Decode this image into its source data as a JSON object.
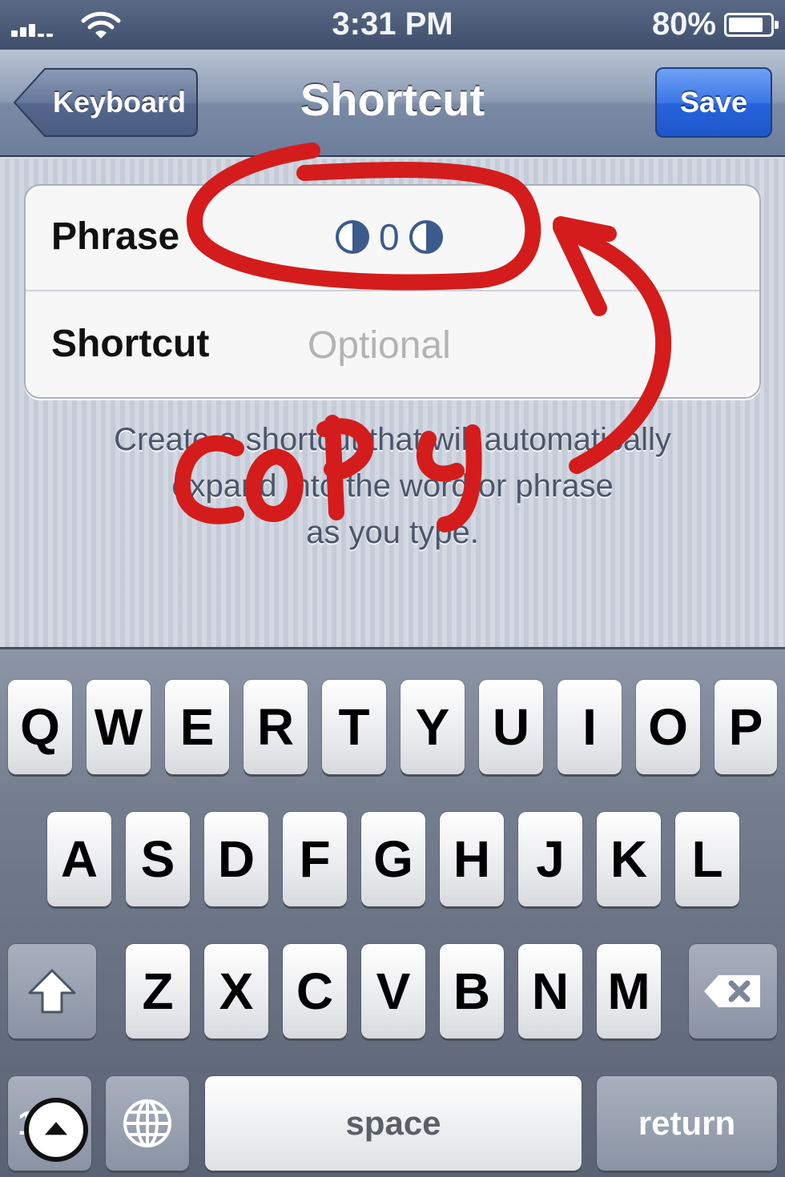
{
  "status_bar": {
    "time": "3:31 PM",
    "battery_percent": "80%",
    "battery_level": 0.8,
    "icons": [
      "signal-icon",
      "wifi-icon",
      "battery-icon"
    ]
  },
  "nav": {
    "back_label": "Keyboard",
    "title": "Shortcut",
    "save_label": "Save"
  },
  "form": {
    "phrase_label": "Phrase",
    "phrase_zero": "0",
    "phrase_value_icons": [
      "half-circle-icon",
      "half-circle-icon"
    ],
    "shortcut_label": "Shortcut",
    "shortcut_placeholder": "Optional"
  },
  "footer_lines": [
    "Create a shortcut that will automatically",
    "expand into the word or phrase",
    "as you type."
  ],
  "annotation": {
    "text": "COPY",
    "color": "#d41c1c"
  },
  "keyboard": {
    "row1": [
      "Q",
      "W",
      "E",
      "R",
      "T",
      "Y",
      "U",
      "I",
      "O",
      "P"
    ],
    "row2": [
      "A",
      "S",
      "D",
      "F",
      "G",
      "H",
      "J",
      "K",
      "L"
    ],
    "row3": [
      "Z",
      "X",
      "C",
      "V",
      "B",
      "N",
      "M"
    ],
    "numbers_label": "123",
    "space_label": "space",
    "return_label": "return",
    "icons": [
      "shift-icon",
      "delete-icon",
      "globe-icon",
      "assistive-touch-icon"
    ]
  },
  "colors": {
    "accent_save": "#2f6fe0",
    "annotation_red": "#d41c1c"
  }
}
